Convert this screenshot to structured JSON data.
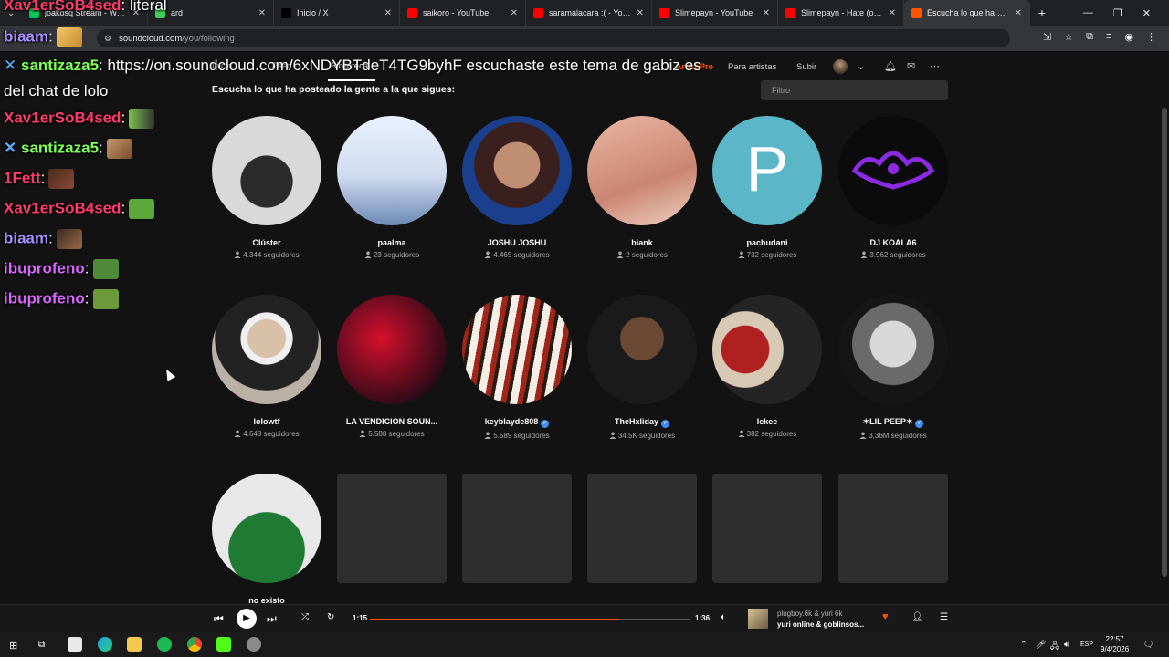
{
  "browser": {
    "tabs": [
      {
        "title": "joakosq Stream - Watch",
        "fav": "#00c853"
      },
      {
        "title": "ard",
        "fav": "#3ccf5a"
      },
      {
        "title": "Inicio / X",
        "fav": "#000000"
      },
      {
        "title": "saikoro - YouTube",
        "fav": "#ff0000"
      },
      {
        "title": "saramalacara :( - YouTube",
        "fav": "#ff0000"
      },
      {
        "title": "Slimepayn - YouTube",
        "fav": "#ff0000"
      },
      {
        "title": "Slimepayn - Hate (official",
        "fav": "#ff0000"
      },
      {
        "title": "Escucha lo que ha postea",
        "fav": "#ff5500"
      }
    ],
    "url_host": "soundcloud.com",
    "url_path": "/you/following"
  },
  "header": {
    "tabs": [
      "Inicio",
      "Feed",
      "Biblioteca"
    ],
    "artist_pro": "Artist Pro",
    "for_artists": "Para artistas",
    "upload": "Subir"
  },
  "page": {
    "title": "Escucha lo que ha posteado la gente a la que sigues:",
    "filter_placeholder": "Filtro"
  },
  "following": [
    {
      "name": "Clúster",
      "followers": "4.344 seguidores",
      "verified": false
    },
    {
      "name": "paalma",
      "followers": "23 seguidores",
      "verified": false
    },
    {
      "name": "JOSHU JOSHU",
      "followers": "4.465 seguidores",
      "verified": false
    },
    {
      "name": "biank",
      "followers": "2 seguidores",
      "verified": false
    },
    {
      "name": "pachudani",
      "followers": "732 seguidores",
      "verified": false
    },
    {
      "name": "DJ KOALA6",
      "followers": "3.962 seguidores",
      "verified": false
    },
    {
      "name": "lolowtf",
      "followers": "4.648 seguidores",
      "verified": false
    },
    {
      "name": "LA VENDICION SOUN...",
      "followers": "5.588 seguidores",
      "verified": false
    },
    {
      "name": "keyblayde808",
      "followers": "5.589 seguidores",
      "verified": true
    },
    {
      "name": "TheHxliday",
      "followers": "34,5K seguidores",
      "verified": true
    },
    {
      "name": "lekee",
      "followers": "382 seguidores",
      "verified": false
    },
    {
      "name": "✶LIL PEEP✶",
      "followers": "3,36M seguidores",
      "verified": true
    },
    {
      "name": "no existo",
      "followers": "",
      "verified": false
    }
  ],
  "chat": {
    "top_line": {
      "user": "Xav1erSoB4sed",
      "text": "literal"
    },
    "second_user": "biaam",
    "long_message_user": "santizaza5",
    "long_message": "https://on.soundcloud.com/6xNDYBTdeT4TG9byhF escuchaste este tema de gabiz es",
    "long_message_cont": "del chat de lolo",
    "lines": [
      {
        "user": "Xav1erSoB4sed",
        "color": "#ff3b6b"
      },
      {
        "user": "santizaza5",
        "color": "#7fff5a"
      },
      {
        "user": "1Fett",
        "color": "#ff3b6b"
      },
      {
        "user": "Xav1erSoB4sed",
        "color": "#ff3b6b"
      },
      {
        "user": "biaam",
        "color": "#a98cff"
      },
      {
        "user": "ibuprofeno",
        "color": "#d966ff"
      },
      {
        "user": "ibuprofeno",
        "color": "#d966ff"
      }
    ]
  },
  "player": {
    "elapsed": "1:15",
    "duration": "1:36",
    "progress_fraction": 0.78,
    "artist": "plugboy.6k & yuri 6k",
    "title": "yuri online & goblinsos..."
  },
  "taskbar": {
    "lang": "ESP",
    "time": "22:57",
    "date": "9/4/2026"
  }
}
